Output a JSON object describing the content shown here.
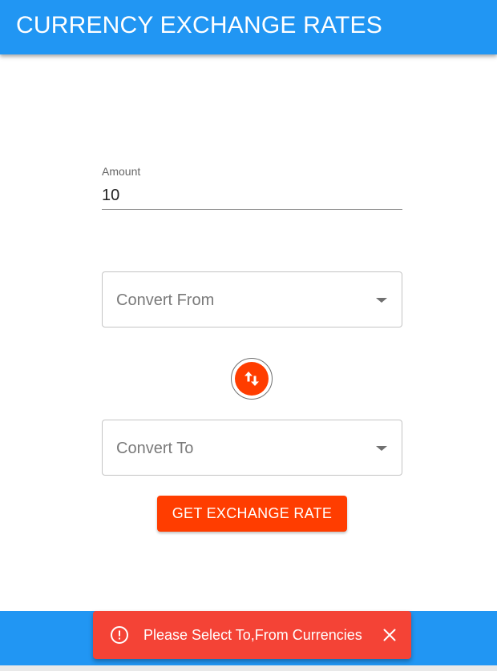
{
  "app_bar": {
    "title": "CURRENCY EXCHANGE RATES"
  },
  "form": {
    "amount": {
      "label": "Amount",
      "value": "10"
    },
    "convert_from": {
      "placeholder": "Convert From",
      "icon": "chevron-down-icon"
    },
    "swap": {
      "icon": "swap-vertical-icon"
    },
    "convert_to": {
      "placeholder": "Convert To",
      "icon": "chevron-down-icon"
    },
    "submit_label": "GET EXCHANGE RATE"
  },
  "snackbar": {
    "icon": "error-outline-icon",
    "message": "Please Select To,From Currencies",
    "close_icon": "close-icon"
  },
  "colors": {
    "primary": "#2196f3",
    "accent": "#ff3d00",
    "error": "#f44336"
  }
}
